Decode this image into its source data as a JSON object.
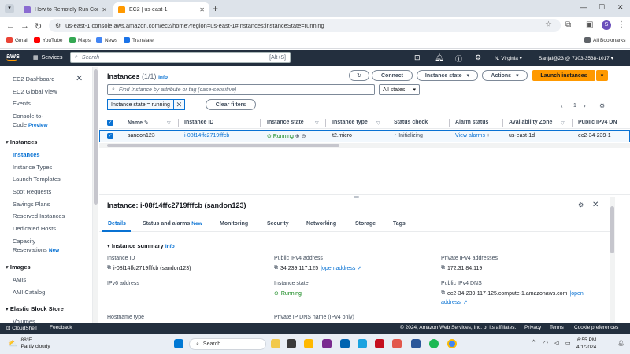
{
  "browser": {
    "tabs": [
      {
        "title": "How to Remotely Run Comma",
        "active": false
      },
      {
        "title": "EC2 | us-east-1",
        "active": true
      }
    ],
    "url": "us-east-1.console.aws.amazon.com/ec2/home?region=us-east-1#Instances:instanceState=running",
    "bookmarks": [
      "Gmail",
      "YouTube",
      "Maps",
      "News",
      "Translate"
    ],
    "all_bookmarks": "All Bookmarks",
    "profile_initial": "S"
  },
  "aws_nav": {
    "logo": "aws",
    "services": "Services",
    "search_placeholder": "Search",
    "search_shortcut": "[Alt+S]",
    "region": "N. Virginia ▾",
    "account": "Sanjai@23 @ 7303-3538-1017 ▾"
  },
  "sidebar": {
    "items": [
      {
        "label": "EC2 Dashboard"
      },
      {
        "label": "EC2 Global View"
      },
      {
        "label": "Events"
      },
      {
        "label": "Console-to-"
      },
      {
        "label": "Code"
      },
      {
        "label": "Preview"
      }
    ],
    "instances_header": "Instances",
    "instances_items": [
      "Instances",
      "Instance Types",
      "Launch Templates",
      "Spot Requests",
      "Savings Plans",
      "Reserved Instances",
      "Dedicated Hosts",
      "Capacity",
      "Reservations"
    ],
    "new_badge": "New",
    "images_header": "Images",
    "images_items": [
      "AMIs",
      "AMI Catalog"
    ],
    "ebs_header": "Elastic Block Store",
    "ebs_items": [
      "Volumes"
    ]
  },
  "instances_panel": {
    "title": "Instances",
    "count": "(1/1)",
    "info": "Info",
    "connect": "Connect",
    "instance_state": "Instance state",
    "actions": "Actions",
    "launch": "Launch instances",
    "find_placeholder": "Find Instance by attribute or tag (case-sensitive)",
    "all_states": "All states",
    "filter_token": "Instance state = running",
    "clear_filters": "Clear filters",
    "page": "1"
  },
  "table": {
    "headers": [
      "Name",
      "Instance ID",
      "Instance state",
      "Instance type",
      "Status check",
      "Alarm status",
      "Availability Zone",
      "Public IPv4 DN"
    ],
    "row": {
      "name": "sandon123",
      "id": "i-08f14ffc2719fffcb",
      "state": "Running",
      "type": "t2.micro",
      "status": "Initializing",
      "alarm": "View alarms",
      "az": "us-east-1d",
      "dns": "ec2-34-239-1"
    }
  },
  "detail": {
    "title": "Instance: i-08f14ffc2719fffcb (sandon123)",
    "tabs": [
      "Details",
      "Status and alarms",
      "Monitoring",
      "Security",
      "Networking",
      "Storage",
      "Tags"
    ],
    "tab_new": "New",
    "summary_head": "Instance summary",
    "summary_info": "info",
    "fields": {
      "instance_id_label": "Instance ID",
      "instance_id_value": "i-08f14ffc2719fffcb (sandon123)",
      "ipv6_label": "IPv6 address",
      "ipv6_value": "–",
      "hostname_label": "Hostname type",
      "public_ip_label": "Public IPv4 address",
      "public_ip_value": "34.239.117.125",
      "open_address": "open address",
      "state_label": "Instance state",
      "state_value": "Running",
      "private_dns_label": "Private IP DNS name (IPv4 only)",
      "private_ip_label": "Private IPv4 addresses",
      "private_ip_value": "172.31.84.119",
      "public_dns_label": "Public IPv4 DNS",
      "public_dns_value": "ec2-34-239-117-125.compute-1.amazonaws.com",
      "open": "open",
      "address": "address"
    }
  },
  "footer": {
    "cloudshell": "CloudShell",
    "feedback": "Feedback",
    "copyright": "© 2024, Amazon Web Services, Inc. or its affiliates.",
    "privacy": "Privacy",
    "terms": "Terms",
    "cookies": "Cookie preferences"
  },
  "taskbar": {
    "temp": "88°F",
    "weather": "Partly cloudy",
    "search": "Search",
    "time": "6:55 PM",
    "date": "4/1/2024"
  },
  "colors": {
    "aws_dark": "#232f3e",
    "aws_orange": "#ff9900",
    "link_blue": "#0972d3",
    "running_green": "#037f0c"
  }
}
